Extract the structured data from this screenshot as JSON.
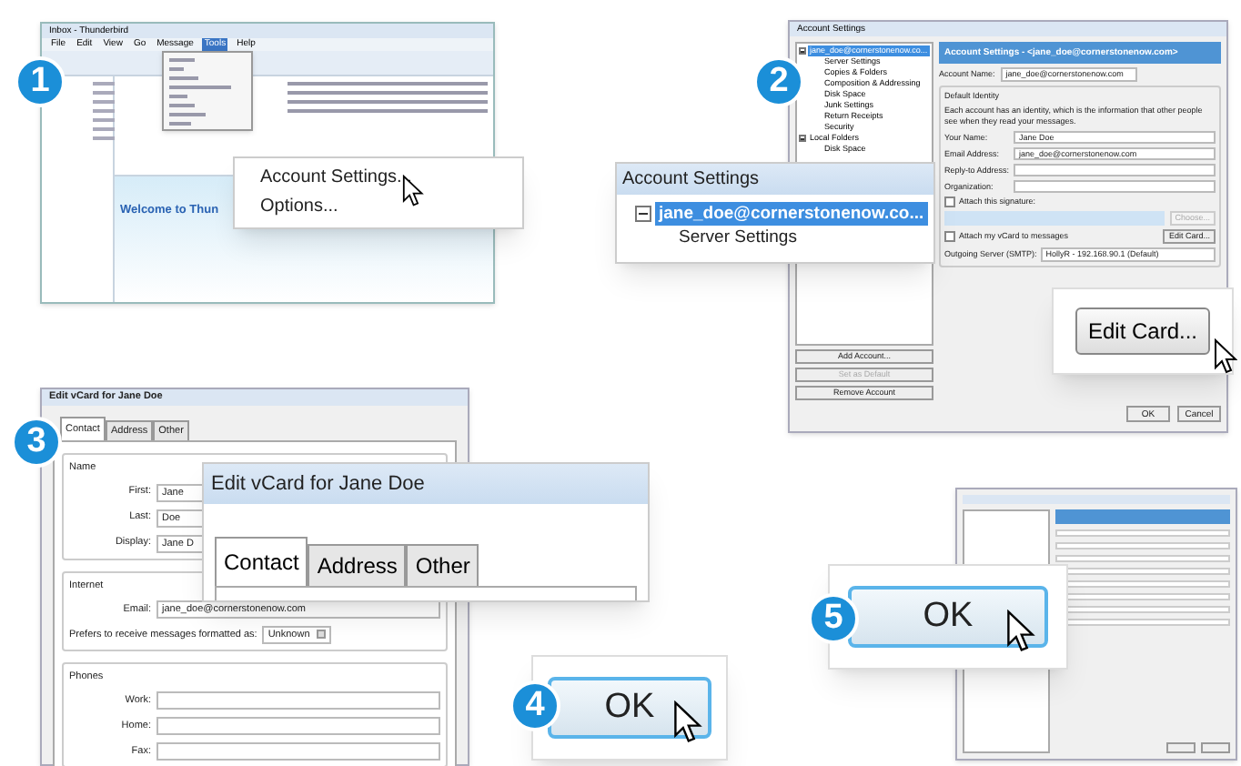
{
  "step1": {
    "badge": "1",
    "window": {
      "title": "Inbox - Thunderbird",
      "menubar": [
        {
          "label": "File",
          "selected": false
        },
        {
          "label": "Edit",
          "selected": false
        },
        {
          "label": "View",
          "selected": false
        },
        {
          "label": "Go",
          "selected": false
        },
        {
          "label": "Message",
          "selected": false
        },
        {
          "label": "Tools",
          "selected": true
        },
        {
          "label": "Help",
          "selected": false
        }
      ],
      "welcome": "Welcome to Thun"
    },
    "callout": {
      "items": [
        "Account Settings...",
        "Options..."
      ]
    }
  },
  "step2": {
    "badge": "2",
    "window": {
      "title": "Account Settings",
      "tree": [
        {
          "label": "jane_doe@cornerstonenow.co...",
          "selected": true,
          "children": [
            {
              "label": "Server Settings"
            },
            {
              "label": "Copies & Folders"
            },
            {
              "label": "Composition & Addressing"
            },
            {
              "label": "Disk Space"
            },
            {
              "label": "Junk Settings"
            },
            {
              "label": "Return Receipts"
            },
            {
              "label": "Security"
            }
          ]
        },
        {
          "label": "Local Folders",
          "selected": false,
          "children": [
            {
              "label": "Disk Space"
            }
          ]
        }
      ],
      "left_buttons": [
        {
          "label": "Add Account...",
          "disabled": false
        },
        {
          "label": "Set as Default",
          "disabled": true
        },
        {
          "label": "Remove Account",
          "disabled": false
        }
      ],
      "header": "Account Settings - <jane_doe@cornerstonenow.com>",
      "account_name": {
        "label": "Account Name:",
        "value": "jane_doe@cornerstonenow.com"
      },
      "group": "Default Identity",
      "description": "Each account has an identity, which is the information that other people see when they read your messages.",
      "fields": [
        {
          "label": "Your Name:",
          "value": "Jane Doe"
        },
        {
          "label": "Email Address:",
          "value": "jane_doe@cornerstonenow.com"
        },
        {
          "label": "Reply-to Address:"
        },
        {
          "label": "Organization:"
        }
      ],
      "signature": {
        "label": "Attach this signature:",
        "checked": false
      },
      "choose": "Choose...",
      "vcard": {
        "label": "Attach my vCard to messages",
        "checked": false
      },
      "edit_card": "Edit Card...",
      "smtp": {
        "label": "Outgoing Server (SMTP):",
        "value": "HollyR - 192.168.90.1 (Default)"
      },
      "buttons": [
        "OK",
        "Cancel"
      ]
    },
    "callout_tree": {
      "title": "Account Settings",
      "account": "jane_doe@cornerstonenow.co...",
      "child": "Server Settings"
    },
    "callout_button": "Edit Card..."
  },
  "step3": {
    "badge": "3",
    "window": {
      "title": "Edit vCard for Jane Doe",
      "tabs": [
        {
          "label": "Contact",
          "selected": true
        },
        {
          "label": "Address",
          "selected": false
        },
        {
          "label": "Other",
          "selected": false
        }
      ],
      "groups": [
        {
          "title": "Name",
          "fields": [
            {
              "label": "First:",
              "value": "Jane"
            },
            {
              "label": "Last:",
              "value": "Doe"
            },
            {
              "label": "Display:",
              "value": "Jane D"
            }
          ]
        },
        {
          "title": "Internet",
          "fields": [
            {
              "label": "Email:",
              "value": "jane_doe@cornerstonenow.com"
            }
          ],
          "format": {
            "label": "Prefers to receive messages formatted as:",
            "value": "Unknown"
          }
        },
        {
          "title": "Phones",
          "fields": [
            {
              "label": "Work:"
            },
            {
              "label": "Home:"
            },
            {
              "label": "Fax:"
            }
          ]
        }
      ]
    },
    "callout": {
      "title": "Edit vCard for Jane Doe",
      "tabs": [
        {
          "label": "Contact",
          "selected": true
        },
        {
          "label": "Address",
          "selected": false
        },
        {
          "label": "Other",
          "selected": false
        }
      ]
    }
  },
  "step4": {
    "badge": "4",
    "button": "OK"
  },
  "step5": {
    "badge": "5",
    "button": "OK"
  }
}
